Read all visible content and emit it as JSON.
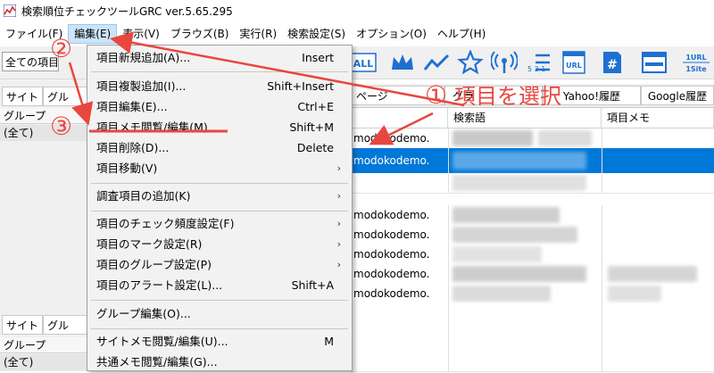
{
  "window": {
    "title": "検索順位チェックツールGRC  ver.5.65.295"
  },
  "menubar": {
    "items": [
      {
        "label": "ファイル(F)"
      },
      {
        "label": "編集(E)"
      },
      {
        "label": "表示(V)"
      },
      {
        "label": "ブラウズ(B)"
      },
      {
        "label": "実行(R)"
      },
      {
        "label": "検索設定(S)"
      },
      {
        "label": "オプション(O)"
      },
      {
        "label": "ヘルプ(H)"
      }
    ]
  },
  "toolbar": {
    "combo_value": "全ての項目",
    "icons": [
      "all-icon",
      "crown-icon",
      "trend-line-icon",
      "star-icon",
      "broadcast-icon",
      "ranking-icon",
      "url-icon",
      "hashtag-icon",
      "window-icon",
      "one-url-one-site-icon"
    ],
    "all_label": "ALL",
    "url_label": "URL",
    "hash_label": "#",
    "rank_label": "5 3 1",
    "one_url_label": "1URL",
    "one_site_label": "1Site"
  },
  "left_panel_top": {
    "tab_site": "サイト",
    "tab_group": "グル",
    "header": "グループ",
    "row": "(全て)"
  },
  "left_panel_bottom": {
    "tab_site": "サイト",
    "tab_group": "グル",
    "header": "グループ",
    "row": "(全て)"
  },
  "grid": {
    "tabs": [
      "ページ",
      "グラ",
      "Yahoo!履歴",
      "Google履歴"
    ],
    "headers": {
      "keyword": "検索語",
      "memo": "項目メモ"
    },
    "rows": [
      {
        "site": "modokodemo."
      },
      {
        "site": "modokodemo."
      },
      {
        "site": "modokodemo."
      },
      {
        "site": "modokodemo."
      },
      {
        "site": "modokodemo."
      },
      {
        "site": "modokodemo."
      },
      {
        "site": "modokodemo."
      }
    ]
  },
  "edit_menu": {
    "items": [
      {
        "label": "項目新規追加(A)...",
        "shortcut": "Insert"
      },
      {
        "label": "項目複製追加(I)...",
        "shortcut": "Shift+Insert"
      },
      {
        "label": "項目編集(E)...",
        "shortcut": "Ctrl+E"
      },
      {
        "label": "項目メモ閲覧/編集(M)...",
        "shortcut": "Shift+M"
      },
      {
        "label": "項目削除(D)...",
        "shortcut": "Delete"
      },
      {
        "label": "項目移動(V)",
        "shortcut": ""
      },
      {
        "label": "調査項目の追加(K)",
        "shortcut": ""
      },
      {
        "label": "項目のチェック頻度設定(F)",
        "shortcut": ""
      },
      {
        "label": "項目のマーク設定(R)",
        "shortcut": ""
      },
      {
        "label": "項目のグループ設定(P)",
        "shortcut": ""
      },
      {
        "label": "項目のアラート設定(L)...",
        "shortcut": "Shift+A"
      },
      {
        "label": "グループ編集(O)...",
        "shortcut": ""
      },
      {
        "label": "サイトメモ閲覧/編集(U)...",
        "shortcut": "M"
      },
      {
        "label": "共通メモ閲覧/編集(G)...",
        "shortcut": ""
      }
    ],
    "submenu_arrow": "›"
  },
  "annotations": {
    "step1_num": "①",
    "step1_text": "項目を選択",
    "step2_num": "②",
    "step3_num": "③",
    "color": "#e8473f"
  },
  "colors": {
    "selection": "#0078d7",
    "menu_highlight": "#cce4f7",
    "annotation": "#e8473f"
  }
}
